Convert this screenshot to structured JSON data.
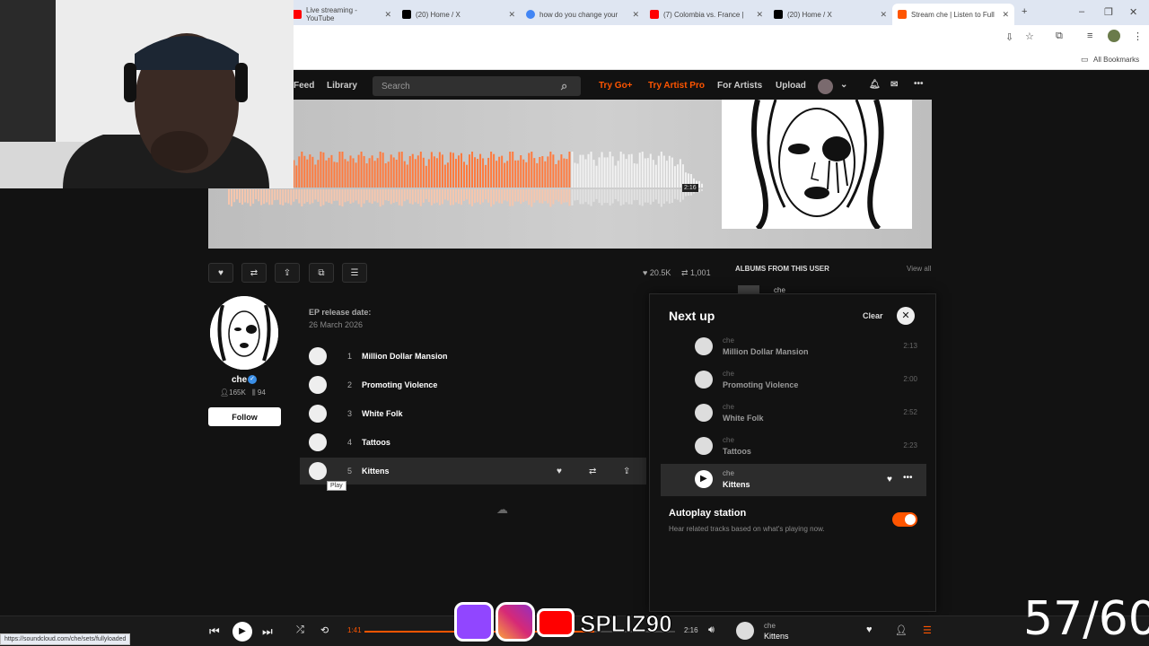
{
  "browser": {
    "tabs": [
      {
        "label": "Live streaming - YouTube",
        "favicon_color": "#ff0000"
      },
      {
        "label": "(20) Home / X",
        "favicon_color": "#000000"
      },
      {
        "label": "how do you change your",
        "favicon_color": "#4285f4"
      },
      {
        "label": "(7) Colombia vs. France |",
        "favicon_color": "#ff0000"
      },
      {
        "label": "(20) Home / X",
        "favicon_color": "#000000"
      },
      {
        "label": "Stream che | Listen to Full",
        "favicon_color": "#ff5500"
      }
    ],
    "bookmarks_label": "All Bookmarks",
    "status_url": "https://soundcloud.com/che/sets/fullyloaded"
  },
  "header": {
    "nav": [
      "Feed",
      "Library"
    ],
    "search_placeholder": "Search",
    "try_go": "Try Go+",
    "try_artist_pro": "Try Artist Pro",
    "for_artists": "For Artists",
    "upload": "Upload"
  },
  "hero": {
    "duration_label": "2:16",
    "played_fraction": 0.72
  },
  "stats": {
    "likes": "20.5K",
    "reposts": "1,001"
  },
  "artist": {
    "name": "che",
    "followers": "165K",
    "tracks": "94",
    "follow_label": "Follow"
  },
  "release": {
    "label": "EP release date:",
    "date": "26 March 2026"
  },
  "tracks": [
    {
      "num": "1",
      "title": "Million Dollar Mansion"
    },
    {
      "num": "2",
      "title": "Promoting Violence"
    },
    {
      "num": "3",
      "title": "White Folk"
    },
    {
      "num": "4",
      "title": "Tattoos"
    },
    {
      "num": "5",
      "title": "Kittens"
    }
  ],
  "tooltip": "Play",
  "sidebar": {
    "albums_heading": "ALBUMS FROM THIS USER",
    "view_all": "View all",
    "album_artist": "che"
  },
  "nextup": {
    "title": "Next up",
    "clear": "Clear",
    "items": [
      {
        "artist": "che",
        "title": "Million Dollar Mansion",
        "duration": "2:13"
      },
      {
        "artist": "che",
        "title": "Promoting Violence",
        "duration": "2:00"
      },
      {
        "artist": "che",
        "title": "White Folk",
        "duration": "2:52"
      },
      {
        "artist": "che",
        "title": "Tattoos",
        "duration": "2:23"
      },
      {
        "artist": "che",
        "title": "Kittens",
        "duration": ""
      }
    ],
    "autoplay_title": "Autoplay station",
    "autoplay_desc": "Hear related tracks based on what's playing now.",
    "autoplay_on": true
  },
  "player": {
    "elapsed": "1:41",
    "duration": "2:16",
    "progress": 0.74,
    "artist": "che",
    "title": "Kittens"
  },
  "overlay": {
    "handle": "SPLIZ90",
    "counter": "57/60"
  },
  "colors": {
    "accent": "#ff5500",
    "bg": "#121212"
  }
}
